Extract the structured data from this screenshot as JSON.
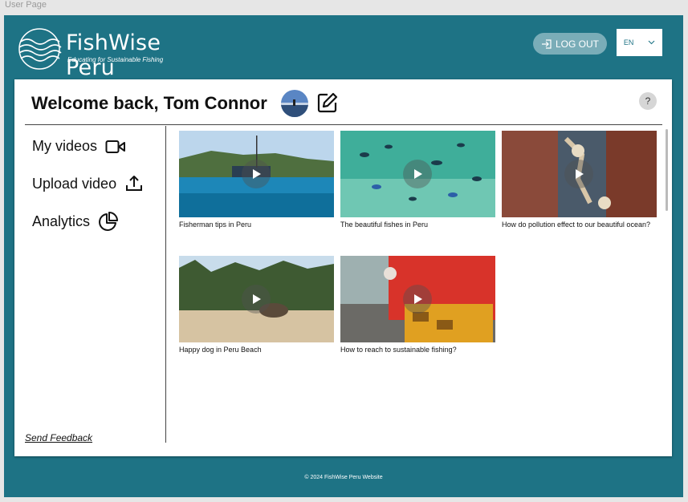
{
  "frame_label": "User Page",
  "brand": {
    "name": "FishWise Peru",
    "tagline": "Educating for Sustainable Fishing"
  },
  "header": {
    "logout_label": "LOG OUT",
    "language": "EN"
  },
  "welcome": "Welcome back, Tom Connor",
  "help_label": "?",
  "sidebar": {
    "items": [
      {
        "label": "My videos",
        "icon": "video-camera-icon"
      },
      {
        "label": "Upload video",
        "icon": "upload-icon"
      },
      {
        "label": "Analytics",
        "icon": "pie-chart-icon"
      }
    ],
    "feedback_label": "Send Feedback"
  },
  "videos": [
    {
      "title": "Fisherman tips in Peru"
    },
    {
      "title": "The beautiful fishes in Peru"
    },
    {
      "title": "How do pollution effect to our beautiful ocean?"
    },
    {
      "title": "Happy dog in Peru Beach"
    },
    {
      "title": "How to reach to sustainable fishing?"
    }
  ],
  "footer": "© 2024 FishWise Peru Website",
  "colors": {
    "brand_teal": "#1e7385",
    "logout_bg": "#7aadb8"
  }
}
